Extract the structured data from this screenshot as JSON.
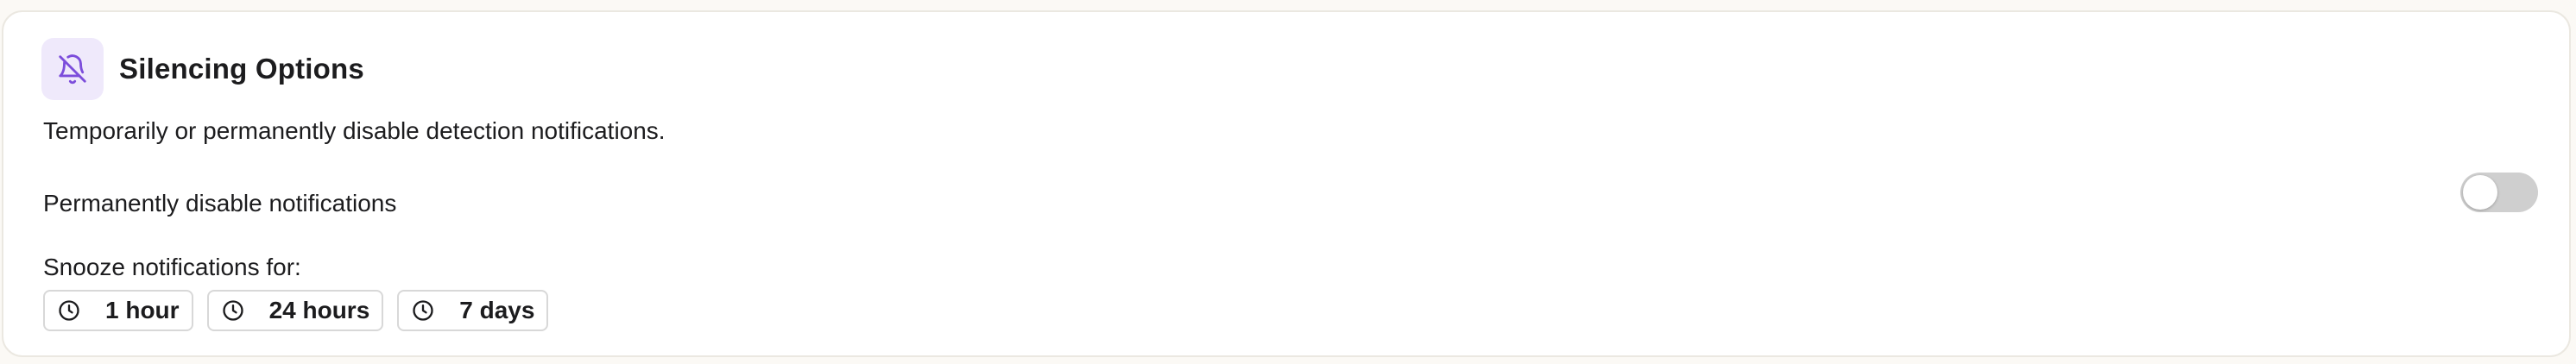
{
  "panel": {
    "title": "Silencing Options",
    "icon": "bell-off-icon",
    "description": "Temporarily or permanently disable detection notifications."
  },
  "permanent": {
    "label": "Permanently disable notifications",
    "enabled": false
  },
  "snooze": {
    "label": "Snooze notifications for:",
    "options": [
      {
        "label": "1 hour",
        "icon": "clock-icon"
      },
      {
        "label": "24 hours",
        "icon": "clock-icon"
      },
      {
        "label": "7 days",
        "icon": "clock-icon"
      }
    ]
  },
  "colors": {
    "accent": "#7c4ddb",
    "icon_badge_bg": "#efe9fb",
    "toggle_off": "#cfcfcf"
  }
}
